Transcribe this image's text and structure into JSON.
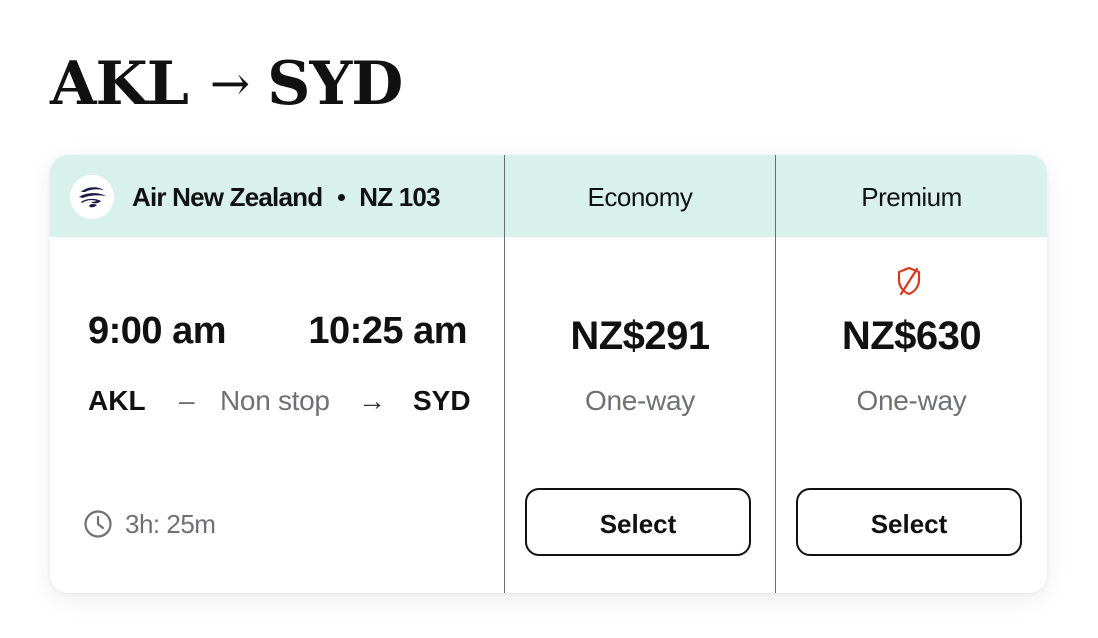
{
  "route": {
    "origin": "AKL",
    "arrow": "→",
    "destination": "SYD"
  },
  "flight": {
    "airline": "Air New Zealand",
    "flight_number": "NZ 103",
    "logo_icon": "koru-icon",
    "departure_time": "9:00 am",
    "arrival_time": "10:25 am",
    "origin_code": "AKL",
    "destination_code": "SYD",
    "dash": "–",
    "stops": "Non stop",
    "arrow": "→",
    "duration": "3h: 25m",
    "duration_icon": "clock-icon"
  },
  "fares": [
    {
      "class": "Economy",
      "price": "NZ$291",
      "trip": "One-way",
      "select_label": "Select"
    },
    {
      "class": "Premium",
      "badge_icon": "shield-off-icon",
      "price": "NZ$630",
      "trip": "One-way",
      "select_label": "Select"
    }
  ],
  "colors": {
    "header_bg": "#d8f1ea",
    "muted_text": "#6f6f77",
    "badge": "#d9381e"
  }
}
